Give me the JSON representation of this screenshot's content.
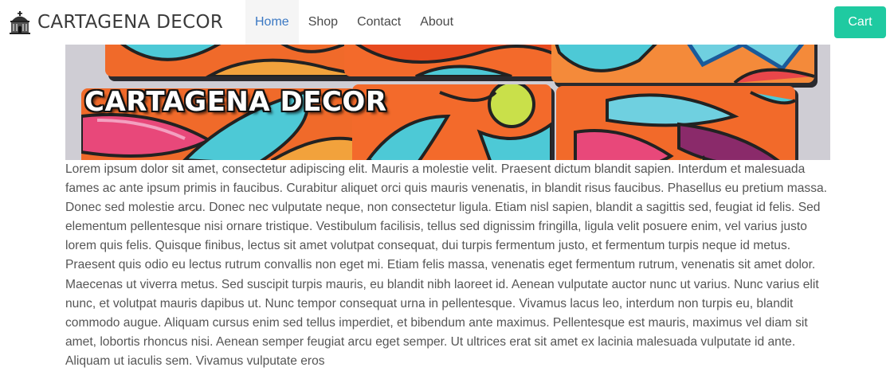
{
  "navbar": {
    "brand": "CARTAGENA DECOR",
    "links": [
      {
        "label": "Home",
        "active": true
      },
      {
        "label": "Shop",
        "active": false
      },
      {
        "label": "Contact",
        "active": false
      },
      {
        "label": "About",
        "active": false
      }
    ],
    "cart_label": "Cart"
  },
  "hero": {
    "title": "CARTAGENA DECOR"
  },
  "main": {
    "paragraph": "Lorem ipsum dolor sit amet, consectetur adipiscing elit. Mauris a molestie velit. Praesent dictum blandit sapien. Interdum et malesuada fames ac ante ipsum primis in faucibus. Curabitur aliquet orci quis mauris venenatis, in blandit risus faucibus. Phasellus eu pretium massa. Donec sed molestie arcu. Donec nec vulputate neque, non consectetur ligula. Etiam nisl sapien, blandit a sagittis sed, feugiat id felis. Sed elementum pellentesque nisi ornare tristique. Vestibulum facilisis, tellus sed dignissim fringilla, ligula velit posuere enim, vel varius justo lorem quis felis. Quisque finibus, lectus sit amet volutpat consequat, dui turpis fermentum justo, et fermentum turpis neque id metus. Praesent quis odio eu lectus rutrum convallis non eget mi. Etiam felis massa, venenatis eget fermentum rutrum, venenatis sit amet dolor. Maecenas ut viverra metus. Sed suscipit turpis mauris, eu blandit nibh laoreet id. Aenean vulputate auctor nunc ut varius. Nunc varius elit nunc, et volutpat mauris dapibus ut. Nunc tempor consequat urna in pellentesque. Vivamus lacus leo, interdum non turpis eu, blandit commodo augue. Aliquam cursus enim sed tellus imperdiet, et bibendum ante maximus. Pellentesque est mauris, maximus vel diam sit amet, lobortis rhoncus nisi. Aenean semper feugiat arcu eget semper. Ut ultrices erat sit amet ex lacinia malesuada vulputate id ante. Aliquam ut iaculis sem. Vivamus vulputate eros"
  },
  "icons": {
    "brand": "church-building-icon"
  },
  "colors": {
    "accent": "#1fcaa1",
    "active_link": "#3a78c3",
    "text": "#555555"
  }
}
